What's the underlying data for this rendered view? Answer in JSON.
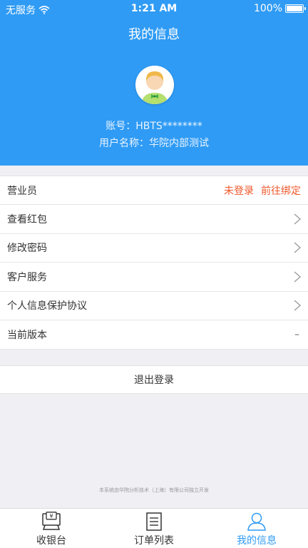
{
  "status": {
    "carrier": "无服务",
    "time": "1:21 AM",
    "battery": "100%"
  },
  "nav": {
    "title": "我的信息"
  },
  "profile": {
    "account": "账号：HBTS********",
    "username": "用户名称：华院内部测试"
  },
  "menu": {
    "items": [
      {
        "label": "营业员",
        "status": "未登录",
        "action": "前往绑定"
      },
      {
        "label": "查看红包"
      },
      {
        "label": "修改密码"
      },
      {
        "label": "客户服务"
      },
      {
        "label": "个人信息保护协议"
      },
      {
        "label": "当前版本",
        "value": "–"
      }
    ]
  },
  "logout_label": "退出登录",
  "footer_note": "本系统由华院分析技术（上海）有限公司独立开发",
  "tabs": [
    {
      "label": "收银台",
      "icon": "cashier-icon"
    },
    {
      "label": "订单列表",
      "icon": "order-list-icon"
    },
    {
      "label": "我的信息",
      "icon": "user-icon"
    }
  ],
  "colors": {
    "primary": "#2f9bf5",
    "warning": "#f0582b"
  }
}
